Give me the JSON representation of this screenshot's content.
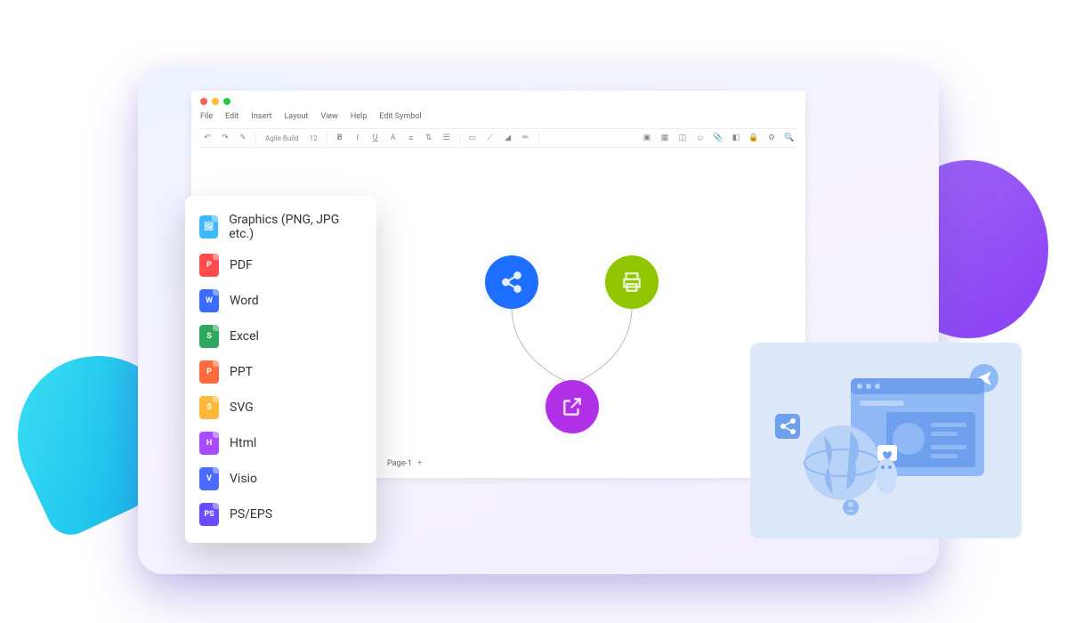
{
  "menubar": {
    "items": [
      "File",
      "Edit",
      "Insert",
      "Layout",
      "View",
      "Help",
      "Edit Symbol"
    ]
  },
  "toolbar": {
    "font_name": "Agile Build",
    "font_size": "12"
  },
  "page_tab": {
    "label": "Page-1"
  },
  "export_menu": {
    "items": [
      {
        "label": "Graphics (PNG, JPG etc.)",
        "icon": "img"
      },
      {
        "label": "PDF",
        "icon": "pdf"
      },
      {
        "label": "Word",
        "icon": "word"
      },
      {
        "label": "Excel",
        "icon": "excel"
      },
      {
        "label": "PPT",
        "icon": "ppt"
      },
      {
        "label": "SVG",
        "icon": "svg"
      },
      {
        "label": "Html",
        "icon": "html"
      },
      {
        "label": "Visio",
        "icon": "visio"
      },
      {
        "label": "PS/EPS",
        "icon": "ps"
      }
    ]
  }
}
